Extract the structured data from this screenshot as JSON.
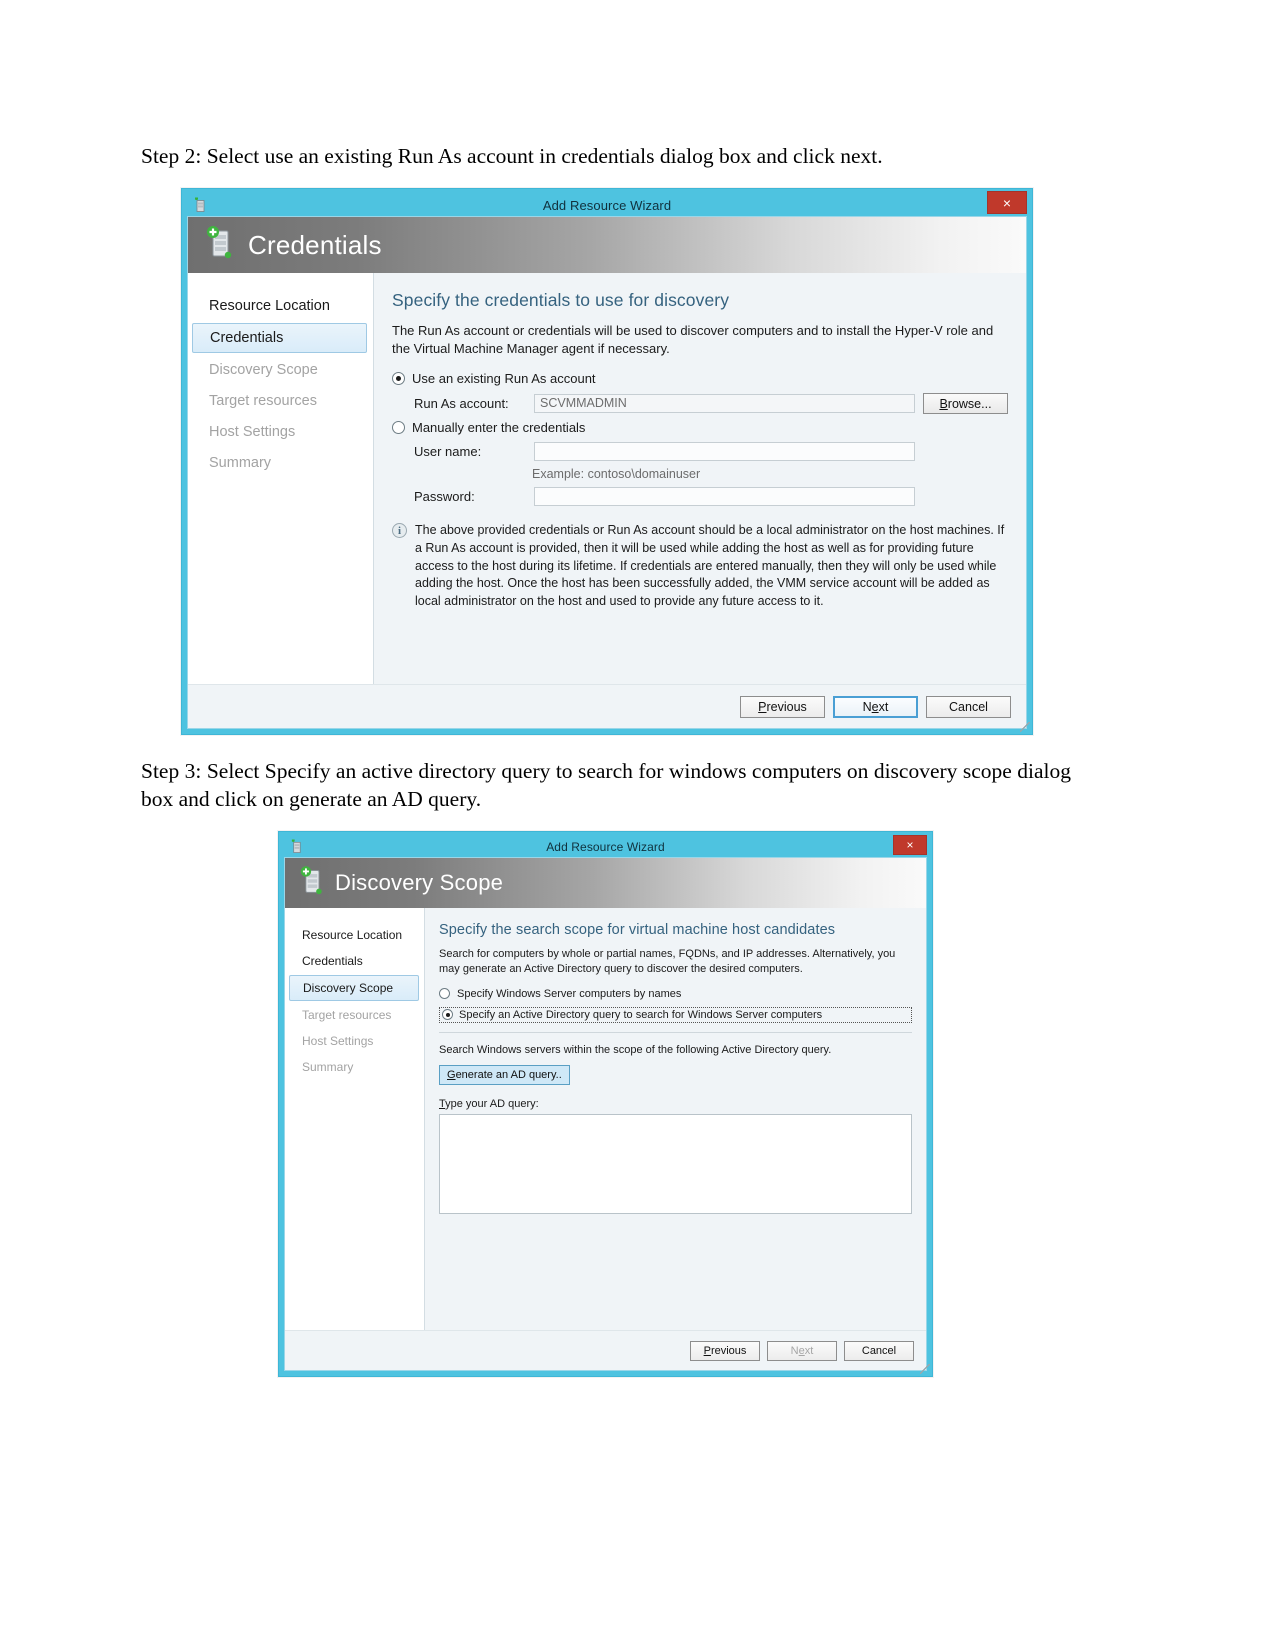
{
  "document": {
    "step2_text": "Step 2: Select use an existing Run As account in credentials dialog box and click next.",
    "step3_text": "Step 3: Select Specify an active directory query to search for windows computers on discovery scope dialog box and click on generate an AD query."
  },
  "colors": {
    "title_bar": "#4ec3e0",
    "close_button": "#c0392b",
    "heading_blue": "#35627f",
    "nav_selected": "#d9ecf9",
    "default_button_border": "#4a9fd4",
    "generate_button": "#cfe8f7"
  },
  "credentials_wizard": {
    "window_title": "Add Resource Wizard",
    "close_label": "×",
    "header_title": "Credentials",
    "nav_items": [
      {
        "label": "Resource Location",
        "state": "done"
      },
      {
        "label": "Credentials",
        "state": "active"
      },
      {
        "label": "Discovery Scope",
        "state": "dim"
      },
      {
        "label": "Target resources",
        "state": "dim"
      },
      {
        "label": "Host Settings",
        "state": "dim"
      },
      {
        "label": "Summary",
        "state": "dim"
      }
    ],
    "content_heading": "Specify the credentials to use for discovery",
    "content_desc": "The Run As account or credentials will be used to discover computers and to install the Hyper-V role and the Virtual Machine Manager agent if necessary.",
    "radio_runas_label": "Use an existing Run As account",
    "radio_runas_selected": true,
    "runas_field_label": "Run As account:",
    "runas_field_value": "SCVMMADMIN",
    "browse_label": "Browse...",
    "radio_manual_label": "Manually enter the credentials",
    "radio_manual_selected": false,
    "username_label": "User name:",
    "username_value": "",
    "username_example": "Example: contoso\\domainuser",
    "password_label": "Password:",
    "password_value": "",
    "info_icon": "info-icon",
    "info_text": "The above provided credentials or Run As account should be a local administrator on the host machines. If a Run As account is provided, then it will be used while adding the host as well as for providing future access to the host during its lifetime. If credentials are entered manually, then they will only be used while adding the host. Once the host has been successfully added, the VMM service account will be added as local administrator on the host and used to provide any future access to it.",
    "buttons": [
      {
        "label": "Previous",
        "style": "normal"
      },
      {
        "label": "Next",
        "style": "default"
      },
      {
        "label": "Cancel",
        "style": "normal"
      }
    ]
  },
  "discovery_wizard": {
    "window_title": "Add Resource Wizard",
    "close_label": "×",
    "header_title": "Discovery Scope",
    "nav_items": [
      {
        "label": "Resource Location",
        "state": "done"
      },
      {
        "label": "Credentials",
        "state": "done"
      },
      {
        "label": "Discovery Scope",
        "state": "active"
      },
      {
        "label": "Target resources",
        "state": "dim"
      },
      {
        "label": "Host Settings",
        "state": "dim"
      },
      {
        "label": "Summary",
        "state": "dim"
      }
    ],
    "content_heading": "Specify the search scope for virtual machine host candidates",
    "content_desc": "Search for computers by whole or partial names, FQDNs, and IP addresses. Alternatively, you may generate an Active Directory query to discover the desired computers.",
    "radio_names_label": "Specify Windows Server computers by names",
    "radio_names_selected": false,
    "radio_adquery_label": "Specify an Active Directory query to search for Windows Server computers",
    "radio_adquery_selected": true,
    "scope_text": "Search Windows servers within the scope of the following Active Directory query.",
    "generate_button_label": "Generate an AD query..",
    "query_label": "Type your AD query:",
    "query_value": "",
    "buttons": [
      {
        "label": "Previous",
        "style": "normal"
      },
      {
        "label": "Next",
        "style": "disabled"
      },
      {
        "label": "Cancel",
        "style": "normal"
      }
    ]
  }
}
